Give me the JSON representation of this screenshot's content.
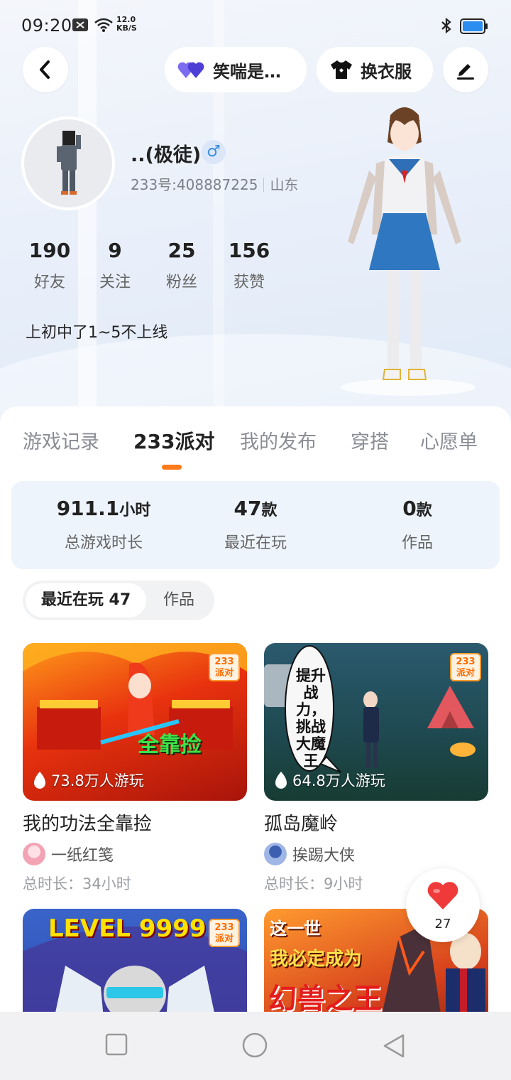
{
  "status_bar": {
    "time": "09:20",
    "net_speed_value": "12.0",
    "net_speed_unit": "KB/S"
  },
  "header": {
    "back_icon": "chevron-left-icon",
    "mood_label": "笑喘是病...",
    "outfit_label": "换衣服",
    "edit_icon": "pencil-icon"
  },
  "profile": {
    "name": "..(极徒)",
    "gender_symbol": "♂",
    "uid": "233号:408887225",
    "region": "山东",
    "bio": "上初中了1~5不上线",
    "stats": [
      {
        "value": "190",
        "label": "好友"
      },
      {
        "value": "9",
        "label": "关注"
      },
      {
        "value": "25",
        "label": "粉丝"
      },
      {
        "value": "156",
        "label": "获赞"
      }
    ]
  },
  "tabs": [
    "游戏记录",
    "233派对",
    "我的发布",
    "穿搭",
    "心愿单"
  ],
  "active_tab_index": 1,
  "summary": [
    {
      "value": "911.1",
      "unit": "小时",
      "label": "总游戏时长"
    },
    {
      "value": "47",
      "unit": "款",
      "label": "最近在玩"
    },
    {
      "value": "0",
      "unit": "款",
      "label": "作品"
    }
  ],
  "segment": {
    "active": "最近在玩 47",
    "inactive": "作品"
  },
  "badge_text": "233派对",
  "games": [
    {
      "title": "我的功法全靠捡",
      "players": "73.8万人游玩",
      "author": "一纸红笺",
      "duration": "总时长：34小时",
      "thumb_text": "全靠捡"
    },
    {
      "title": "孤岛魔岭",
      "players": "64.8万人游玩",
      "author": "挨踢大侠",
      "duration": "总时长：9小时",
      "thumb_text": "提升战力，挑战大魔王"
    },
    {
      "title": "",
      "players": "",
      "author": "",
      "duration": "",
      "thumb_text": "LEVEL 9999"
    },
    {
      "title": "",
      "players": "",
      "author": "",
      "duration": "",
      "thumb_text_1": "这一世",
      "thumb_text_2": "我必定成为",
      "thumb_text_3": "幻兽之王"
    }
  ],
  "like_button": {
    "count": "27"
  },
  "colors": {
    "accent_orange": "#ff7a1a",
    "summary_bg": "#eef4fc",
    "heart_red": "#f03a3a",
    "mood_purple": "#6b5ce7"
  }
}
